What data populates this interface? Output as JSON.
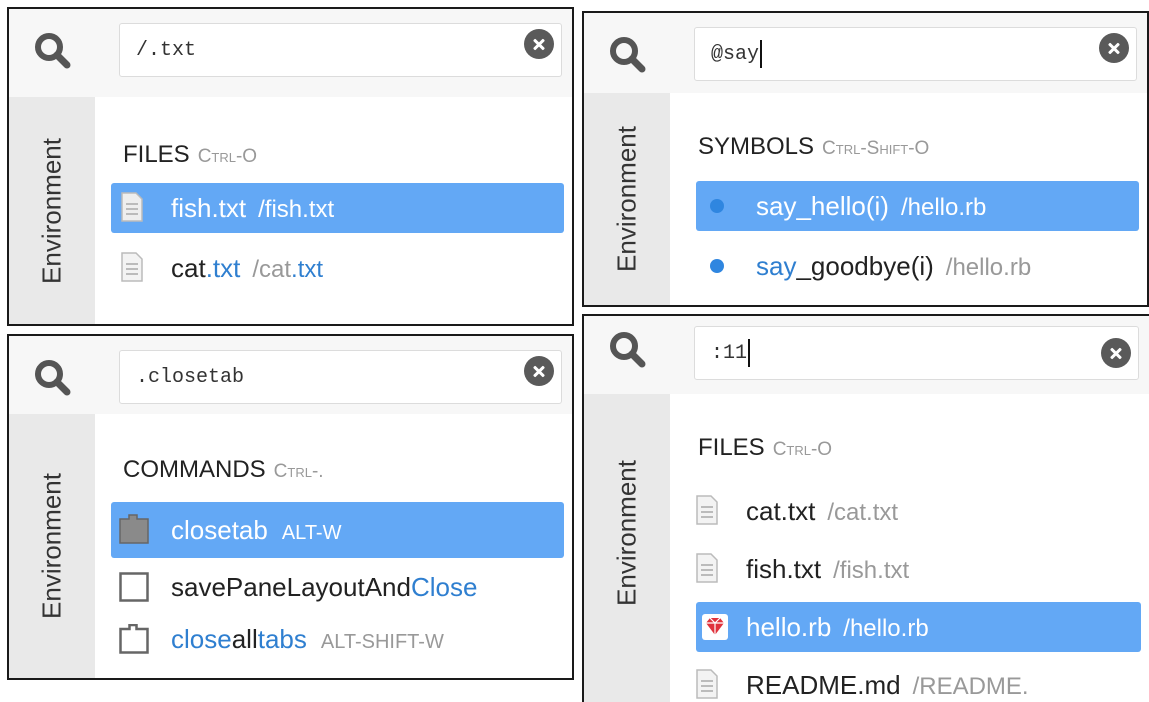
{
  "environment_tab_label": "Environment",
  "panels": [
    {
      "id": "files",
      "query": "/.txt",
      "section": {
        "title": "FILES",
        "shortcut": "Ctrl-O"
      },
      "rows": [
        {
          "name": "fish.txt",
          "path": "/fish.txt",
          "icon": "file-icon",
          "selected": true
        },
        {
          "name_parts": [
            "cat",
            ".txt"
          ],
          "path_parts": [
            "/cat",
            ".txt"
          ],
          "icon": "file-icon",
          "selected": false
        }
      ]
    },
    {
      "id": "symbols",
      "query": "@say",
      "section": {
        "title": "SYMBOLS",
        "shortcut": "Ctrl-Shift-O"
      },
      "rows": [
        {
          "name": "say_hello(i)",
          "path": "/hello.rb",
          "icon": "bullet-icon",
          "selected": true
        },
        {
          "name_parts": [
            "say",
            "_goodbye(i)"
          ],
          "path": "/hello.rb",
          "icon": "bullet-icon",
          "selected": false
        }
      ]
    },
    {
      "id": "commands",
      "query": ".closetab",
      "section": {
        "title": "COMMANDS",
        "shortcut": "Ctrl-."
      },
      "rows": [
        {
          "name": "closetab",
          "key": "ALT-W",
          "icon": "tab-icon",
          "selected": true
        },
        {
          "name_parts": [
            "savePaneLayoutAnd",
            "Close"
          ],
          "icon": "window-icon",
          "selected": false
        },
        {
          "name_parts": [
            "close",
            "all",
            "tabs"
          ],
          "key": "ALT-SHIFT-W",
          "icon": "tab-icon",
          "selected": false
        }
      ]
    },
    {
      "id": "goto-line",
      "query": ":11",
      "section": {
        "title": "FILES",
        "shortcut": "Ctrl-O"
      },
      "rows": [
        {
          "name": "cat.txt",
          "path": "/cat.txt",
          "icon": "file-icon",
          "selected": false
        },
        {
          "name": "fish.txt",
          "path": "/fish.txt",
          "icon": "file-icon",
          "selected": false
        },
        {
          "name": "hello.rb",
          "path": "/hello.rb",
          "icon": "ruby-icon",
          "selected": true
        },
        {
          "name": "README.md",
          "path": "/README.",
          "icon": "file-icon",
          "selected": false
        }
      ]
    }
  ],
  "colors": {
    "selection": "#63a8f5",
    "match_highlight": "#2f7fd0",
    "bullet": "#2f86e0"
  }
}
